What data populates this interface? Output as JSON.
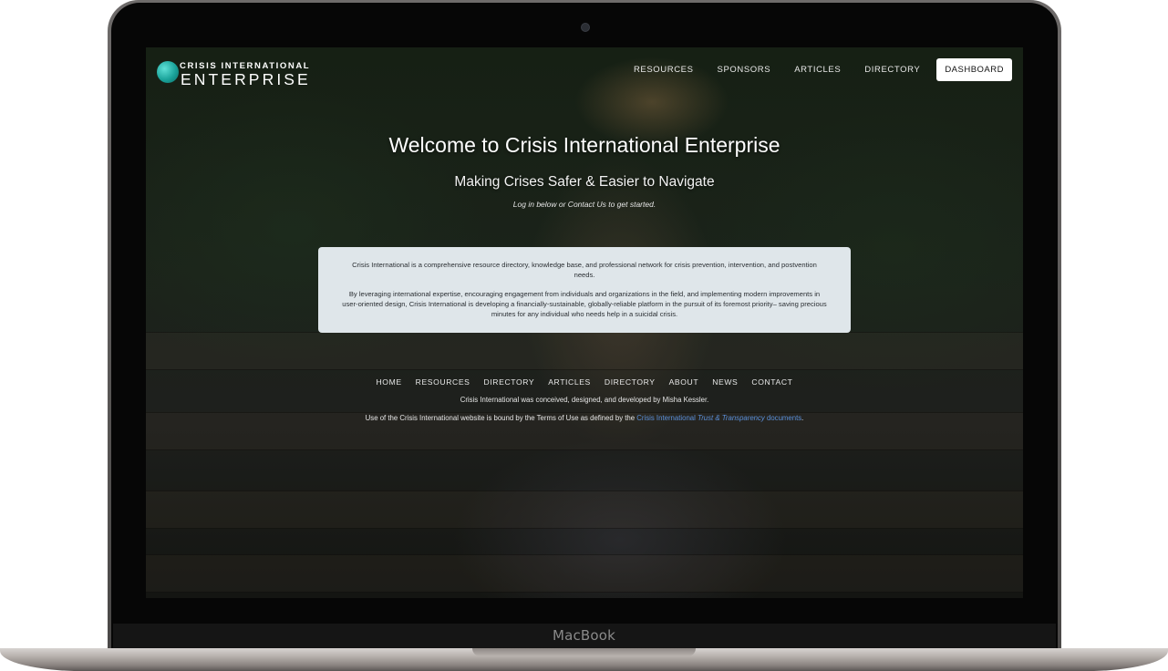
{
  "device": {
    "label": "MacBook"
  },
  "header": {
    "logo": {
      "top": "CRISIS INTERNATIONAL",
      "bottom": "ENTERPRISE"
    },
    "nav": [
      {
        "label": "RESOURCES"
      },
      {
        "label": "SPONSORS"
      },
      {
        "label": "ARTICLES"
      },
      {
        "label": "DIRECTORY"
      }
    ],
    "cta_label": "DASHBOARD"
  },
  "hero": {
    "title": "Welcome to Crisis International Enterprise",
    "subtitle": "Making Crises Safer & Easier to Navigate",
    "cta_text": "Log in below or Contact Us to get started."
  },
  "info": {
    "paragraphs": [
      "Crisis International is a comprehensive resource directory, knowledge base, and professional network for crisis prevention, intervention, and postvention needs.",
      "By leveraging international expertise, encouraging engagement from individuals and organizations in the field, and implementing modern improvements in user-oriented design, Crisis International is developing a financially-sustainable, globally-reliable platform in the pursuit of its foremost priority– saving precious minutes for any individual who needs help in a suicidal crisis."
    ]
  },
  "footer": {
    "links": [
      {
        "label": "HOME"
      },
      {
        "label": "RESOURCES"
      },
      {
        "label": "DIRECTORY"
      },
      {
        "label": "ARTICLES"
      },
      {
        "label": "DIRECTORY"
      },
      {
        "label": "ABOUT"
      },
      {
        "label": "NEWS"
      },
      {
        "label": "CONTACT"
      }
    ],
    "credit": "Crisis International was conceived, designed, and developed by Misha Kessler.",
    "terms_prefix": "Use of the Crisis International website is bound by the Terms of Use as defined by the ",
    "terms_link_a": "Crisis International ",
    "terms_link_b": "Trust & Transparency",
    "terms_link_c": " documents",
    "terms_suffix": "."
  },
  "colors": {
    "accent_logo": "#1aa39a",
    "link": "#5b8fd8",
    "info_box_bg": "#dfe6ea",
    "button_bg": "#ffffff"
  }
}
